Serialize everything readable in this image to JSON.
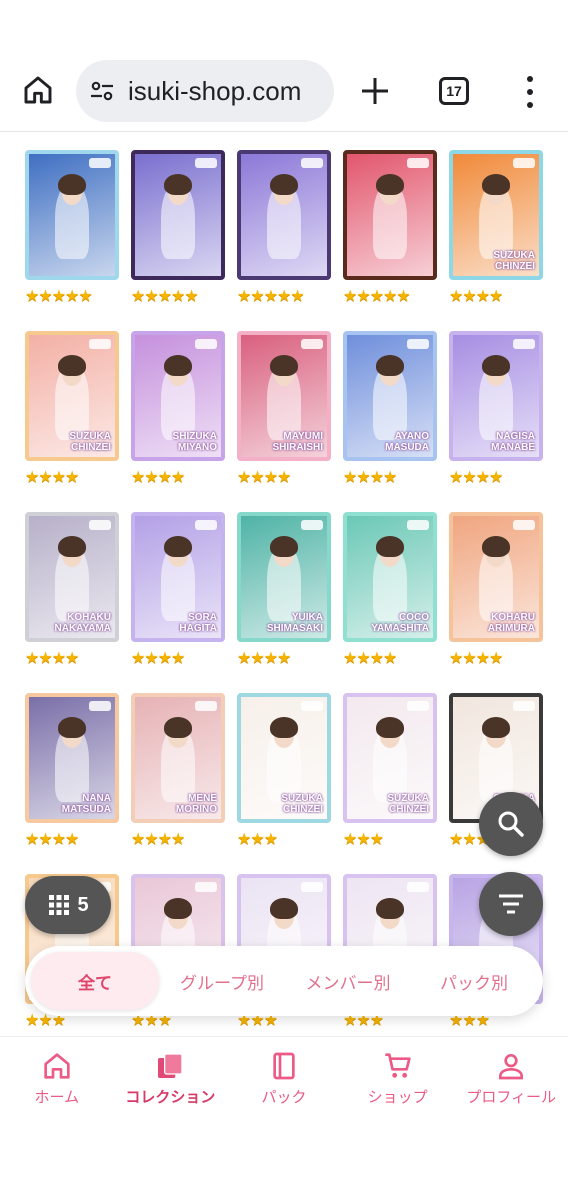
{
  "browser": {
    "url": "isuki-shop.com",
    "tab_count": "17"
  },
  "grid": {
    "cards": [
      {
        "name": "",
        "stars": "★★★★★",
        "frame": "#9fd8ec",
        "bg": "#3f6fc2"
      },
      {
        "name": "",
        "stars": "★★★★★",
        "frame": "#3d2a5a",
        "bg": "#7a6fcf"
      },
      {
        "name": "",
        "stars": "★★★★★",
        "frame": "#4b3a72",
        "bg": "#8c78d8"
      },
      {
        "name": "",
        "stars": "★★★★★",
        "frame": "#5a2b1d",
        "bg": "#e2566d"
      },
      {
        "name": "SUZUKA\nCHINZEI",
        "stars": "★★★★",
        "frame": "#8ed7e6",
        "bg": "#f08a3a"
      },
      {
        "name": "SUZUKA\nCHINZEI",
        "stars": "★★★★",
        "frame": "#f6c98f",
        "bg": "#f3b0a5"
      },
      {
        "name": "SHIZUKA\nMIYANO",
        "stars": "★★★★",
        "frame": "#c7a3ea",
        "bg": "#c590dd"
      },
      {
        "name": "MAYUMI\nSHIRAISHI",
        "stars": "★★★★",
        "frame": "#f3b0c7",
        "bg": "#d9607e"
      },
      {
        "name": "AYANO\nMASUDA",
        "stars": "★★★★",
        "frame": "#a7c4f1",
        "bg": "#6f8fdc"
      },
      {
        "name": "NAGISA\nMANABE",
        "stars": "★★★★",
        "frame": "#c8b2ee",
        "bg": "#a68ee3"
      },
      {
        "name": "KOHAKU\nNAKAYAMA",
        "stars": "★★★★",
        "frame": "#cfcfd6",
        "bg": "#b7b0c9"
      },
      {
        "name": "SORA\nHAGITA",
        "stars": "★★★★",
        "frame": "#c5b3ef",
        "bg": "#b3a0e6"
      },
      {
        "name": "YUIKA\nSHIMASAKI",
        "stars": "★★★★",
        "frame": "#86d8cb",
        "bg": "#4fb3a6"
      },
      {
        "name": "COCO\nYAMASHITA",
        "stars": "★★★★",
        "frame": "#8fe0d0",
        "bg": "#6bc8b6"
      },
      {
        "name": "KOHARU\nARIMURA",
        "stars": "★★★★",
        "frame": "#f6c29a",
        "bg": "#f0a57f"
      },
      {
        "name": "NANA\nMATSUDA",
        "stars": "★★★★",
        "frame": "#f6c9a0",
        "bg": "#7a6fa8"
      },
      {
        "name": "MENE\nMORINO",
        "stars": "★★★★",
        "frame": "#f3cdb5",
        "bg": "#e6b2b5"
      },
      {
        "name": "SUZUKA\nCHINZEI",
        "stars": "★★★",
        "frame": "#9ed8e3",
        "bg": "#f7f0ea"
      },
      {
        "name": "SUZUKA\nCHINZEI",
        "stars": "★★★",
        "frame": "#d8c2ef",
        "bg": "#f3e9ee"
      },
      {
        "name": "SUZUKA\nCHINZEI",
        "stars": "★★★",
        "frame": "#3a3a3a",
        "bg": "#f1e6de"
      },
      {
        "name": "",
        "stars": "★★★",
        "frame": "#f6c98f",
        "bg": "#f8d7b8"
      },
      {
        "name": "",
        "stars": "★★★",
        "frame": "#d9c2ec",
        "bg": "#e9c7d7"
      },
      {
        "name": "",
        "stars": "★★★",
        "frame": "#d8c2ef",
        "bg": "#ebe3f3"
      },
      {
        "name": "",
        "stars": "★★★",
        "frame": "#d8c2ef",
        "bg": "#eee5f2"
      },
      {
        "name": "",
        "stars": "★★★",
        "frame": "#c9b5ee",
        "bg": "#b8a4e4"
      }
    ]
  },
  "fab": {
    "grid_count": "5"
  },
  "segments": [
    {
      "label": "全て",
      "active": true
    },
    {
      "label": "グループ別",
      "active": false
    },
    {
      "label": "メンバー別",
      "active": false
    },
    {
      "label": "パック別",
      "active": false
    }
  ],
  "nav": {
    "home": "ホーム",
    "collection": "コレクション",
    "pack": "パック",
    "shop": "ショップ",
    "profile": "プロフィール"
  },
  "colors": {
    "accent": "#ec5a86",
    "star": "#f5b400",
    "fab": "#555555"
  }
}
